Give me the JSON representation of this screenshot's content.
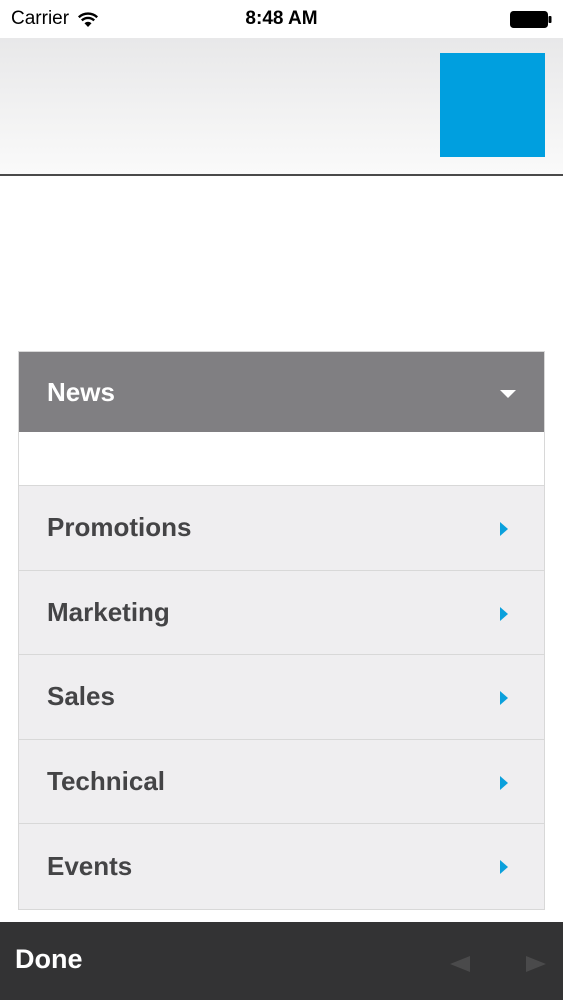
{
  "status_bar": {
    "carrier": "Carrier",
    "time": "8:48 AM",
    "wifi_icon": "wifi-icon",
    "battery_icon": "battery-icon"
  },
  "header": {
    "logo_color": "#009fdf"
  },
  "menu": {
    "title": "News",
    "items": [
      {
        "label": "Promotions"
      },
      {
        "label": "Marketing"
      },
      {
        "label": "Sales"
      },
      {
        "label": "Technical"
      },
      {
        "label": "Events"
      }
    ],
    "accent_color": "#0ba0dc"
  },
  "toolbar": {
    "done_label": "Done"
  }
}
